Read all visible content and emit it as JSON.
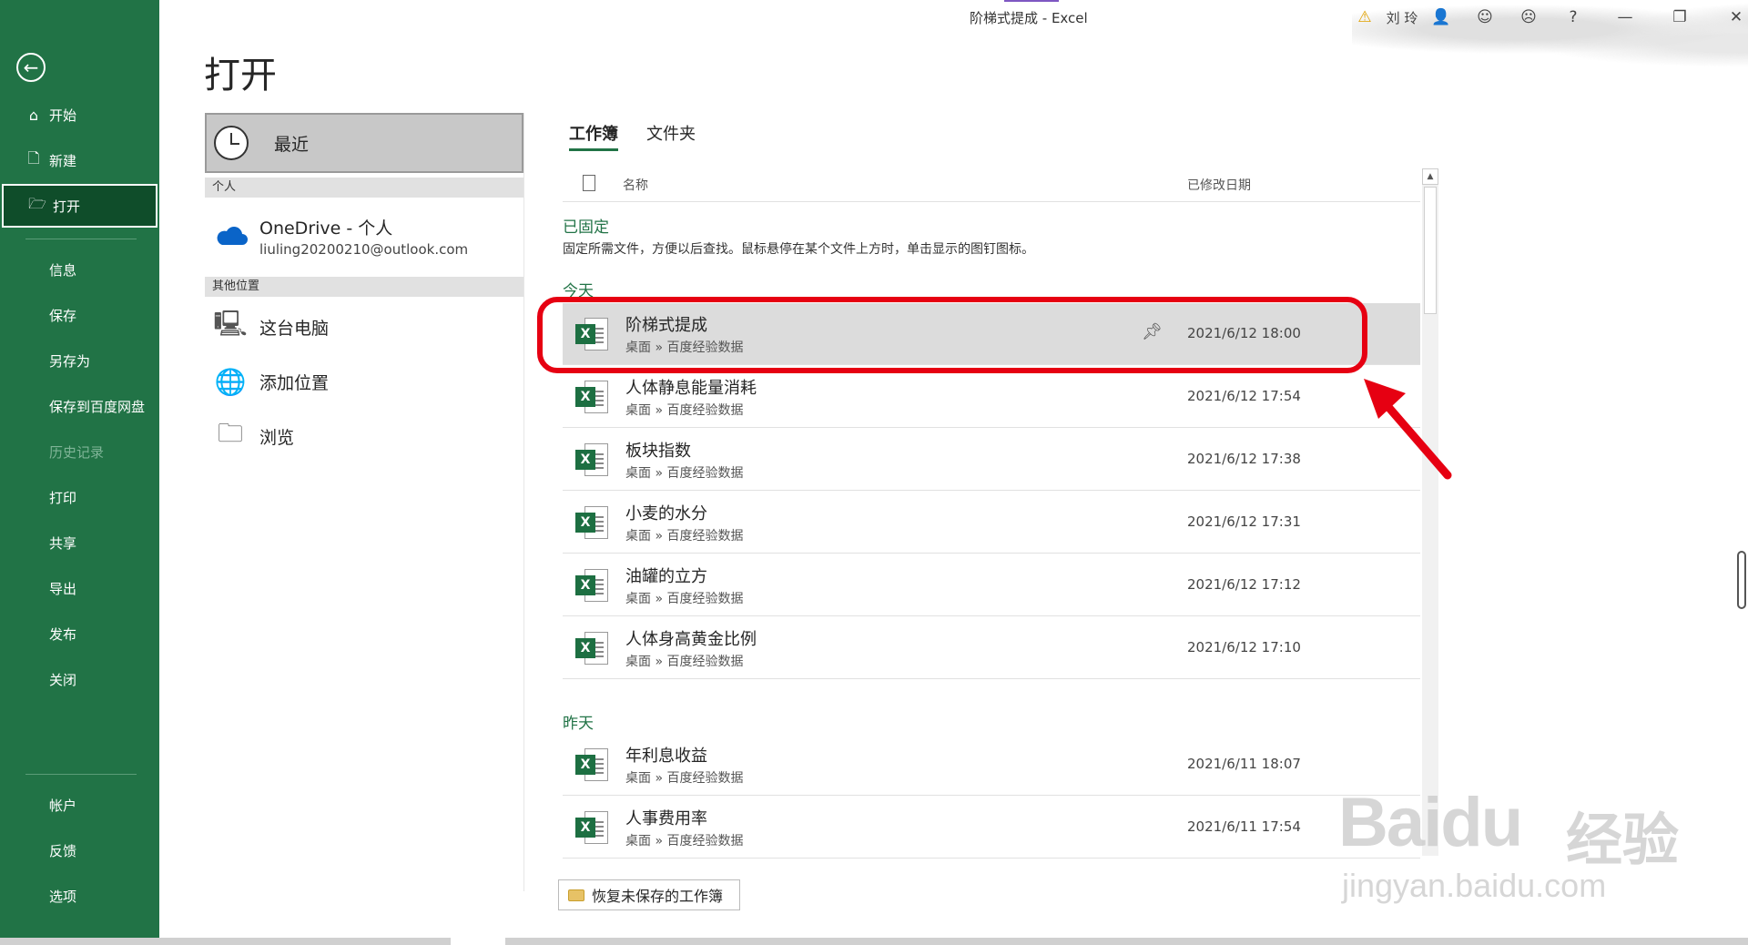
{
  "window": {
    "title": "阶梯式提成  -  Excel",
    "user_name": "刘 玲"
  },
  "nav": {
    "back_label": "←",
    "items": [
      {
        "label": "开始",
        "icon": "home-icon"
      },
      {
        "label": "新建",
        "icon": "new-doc-icon"
      },
      {
        "label": "打开",
        "icon": "open-folder-icon"
      },
      {
        "label": "信息"
      },
      {
        "label": "保存"
      },
      {
        "label": "另存为"
      },
      {
        "label": "保存到百度网盘"
      },
      {
        "label": "历史记录"
      },
      {
        "label": "打印"
      },
      {
        "label": "共享"
      },
      {
        "label": "导出"
      },
      {
        "label": "发布"
      },
      {
        "label": "关闭"
      },
      {
        "label": "帐户"
      },
      {
        "label": "反馈"
      },
      {
        "label": "选项"
      }
    ]
  },
  "page": {
    "title": "打开"
  },
  "locations": {
    "recent": "最近",
    "personal_header": "个人",
    "onedrive": {
      "name": "OneDrive - 个人",
      "account": "liuling20200210@outlook.com"
    },
    "other_header": "其他位置",
    "this_pc": "这台电脑",
    "add_place": "添加位置",
    "browse": "浏览"
  },
  "tabs": {
    "workbooks": "工作簿",
    "folders": "文件夹"
  },
  "columns": {
    "name": "名称",
    "modified": "已修改日期"
  },
  "pinned": {
    "title": "已固定",
    "description": "固定所需文件，方便以后查找。鼠标悬停在某个文件上方时，单击显示的图钉图标。"
  },
  "groups": {
    "today": "今天",
    "yesterday": "昨天"
  },
  "files": {
    "today": [
      {
        "name": "阶梯式提成",
        "path": "桌面 » 百度经验数据",
        "date": "2021/6/12 18:00"
      },
      {
        "name": "人体静息能量消耗",
        "path": "桌面 » 百度经验数据",
        "date": "2021/6/12 17:54"
      },
      {
        "name": "板块指数",
        "path": "桌面 » 百度经验数据",
        "date": "2021/6/12 17:38"
      },
      {
        "name": "小麦的水分",
        "path": "桌面 » 百度经验数据",
        "date": "2021/6/12 17:31"
      },
      {
        "name": "油罐的立方",
        "path": "桌面 » 百度经验数据",
        "date": "2021/6/12 17:12"
      },
      {
        "name": "人体身高黄金比例",
        "path": "桌面 » 百度经验数据",
        "date": "2021/6/12 17:10"
      }
    ],
    "yesterday": [
      {
        "name": "年利息收益",
        "path": "桌面 » 百度经验数据",
        "date": "2021/6/11 18:07"
      },
      {
        "name": "人事费用率",
        "path": "桌面 » 百度经验数据",
        "date": "2021/6/11 17:54"
      }
    ]
  },
  "recover_button": "恢复未保存的工作簿",
  "watermark": {
    "brand": "Baidu",
    "cn": "经验",
    "url": "jingyan.baidu.com"
  },
  "colors": {
    "nav_bg": "#217346",
    "nav_active": "#0f4d2a",
    "accent": "#217346",
    "annotation": "#e60012"
  }
}
